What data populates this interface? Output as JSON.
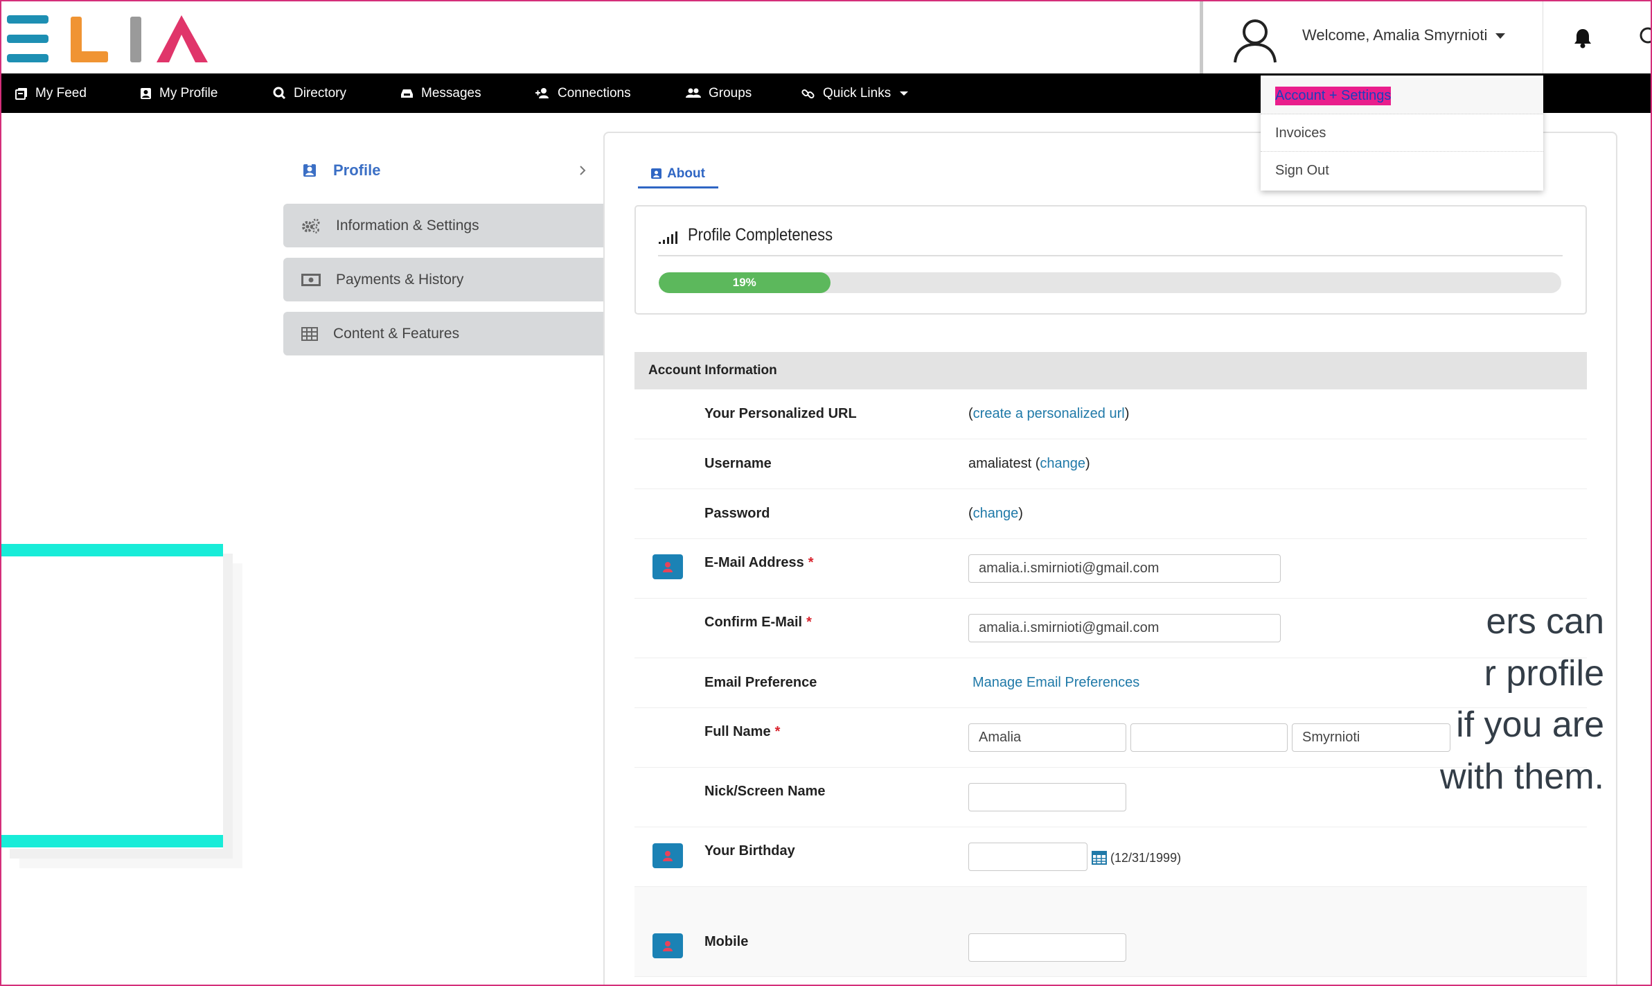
{
  "brand": {
    "name": "ELIA",
    "colors": {
      "e": "#1d8fb3",
      "l": "#f09433",
      "i": "#9a9a9a",
      "a": "#e0356a"
    }
  },
  "header": {
    "welcome": "Welcome, Amalia Smyrnioti",
    "user_icon": "user-icon",
    "bell_icon": "bell-icon"
  },
  "nav": {
    "items": [
      {
        "label": "My Feed",
        "icon": "feed-icon"
      },
      {
        "label": "My Profile",
        "icon": "profile-icon"
      },
      {
        "label": "Directory",
        "icon": "search-icon"
      },
      {
        "label": "Messages",
        "icon": "inbox-icon"
      },
      {
        "label": "Connections",
        "icon": "add-user-icon"
      },
      {
        "label": "Groups",
        "icon": "group-icon"
      },
      {
        "label": "Quick Links",
        "icon": "link-icon"
      }
    ]
  },
  "dropdown": {
    "items": [
      "Account + Settings",
      "Invoices",
      "Sign Out"
    ]
  },
  "sidebar": {
    "profile": "Profile",
    "items": [
      {
        "label": "Information & Settings",
        "icon": "gears-icon"
      },
      {
        "label": "Payments & History",
        "icon": "money-icon"
      },
      {
        "label": "Content & Features",
        "icon": "table-icon"
      }
    ]
  },
  "tabs": {
    "about": "About"
  },
  "profile_completeness": {
    "title": "Profile Completeness",
    "percent": 19,
    "label": "19%"
  },
  "account": {
    "heading": "Account Information",
    "personalized_url": {
      "label": "Your Personalized URL",
      "open": "(",
      "link": "create a personalized url",
      "close": ")"
    },
    "username": {
      "label": "Username",
      "value": "amaliatest",
      "open": " (",
      "link": "change",
      "close": ")"
    },
    "password": {
      "label": "Password",
      "open": "(",
      "link": "change",
      "close": ")"
    },
    "email": {
      "label": "E-Mail Address",
      "value": "amalia.i.smirnioti@gmail.com"
    },
    "confirm_email": {
      "label": "Confirm E-Mail",
      "value": "amalia.i.smirnioti@gmail.com"
    },
    "email_pref": {
      "label": "Email Preference",
      "link": "Manage Email Preferences"
    },
    "full_name": {
      "label": "Full Name",
      "first": "Amalia",
      "middle": "",
      "last": "Smyrnioti"
    },
    "nick": {
      "label": "Nick/Screen Name",
      "value": ""
    },
    "birthday": {
      "label": "Your Birthday",
      "value": "",
      "hint": "(12/31/1999)"
    },
    "mobile": {
      "label": "Mobile",
      "value": ""
    },
    "required_mark": "*"
  },
  "overlay": {
    "text": "ers can\nr profile\n if you are\nwith them."
  }
}
